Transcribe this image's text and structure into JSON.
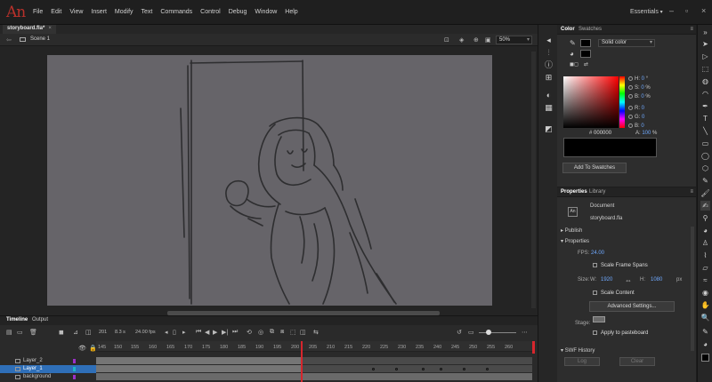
{
  "app": {
    "logo": "An"
  },
  "menu": [
    "File",
    "Edit",
    "View",
    "Insert",
    "Modify",
    "Text",
    "Commands",
    "Control",
    "Debug",
    "Window",
    "Help"
  ],
  "workspace": "Essentials",
  "document": {
    "tab": "storyboard.fla*",
    "close": "×"
  },
  "editbar": {
    "back": "⇦",
    "scene": "Scene 1",
    "zoom": "50%"
  },
  "timeline": {
    "tabs": [
      "Timeline",
      "Output"
    ],
    "frame": "201",
    "time": "8.3 s",
    "fps": "24.00 fps",
    "ruler": [
      "145",
      "150",
      "155",
      "160",
      "165",
      "170",
      "175",
      "180",
      "185",
      "190",
      "195",
      "200",
      "205",
      "210",
      "215",
      "220",
      "225",
      "230",
      "235",
      "240",
      "245",
      "250",
      "255",
      "260"
    ],
    "layers": [
      {
        "name": "Layer_2",
        "color": "#9b30c8",
        "selected": false
      },
      {
        "name": "Layer_1",
        "color": "#1fb5c8",
        "selected": true
      },
      {
        "name": "background",
        "color": "#9b30c8",
        "selected": false
      }
    ],
    "playhead_color": "#d6262d"
  },
  "color_panel": {
    "tabs": [
      "Color",
      "Swatches"
    ],
    "fill_type": "Solid color",
    "fields": [
      {
        "label": "H:",
        "value": "0",
        "unit": "°"
      },
      {
        "label": "S:",
        "value": "0",
        "unit": "%"
      },
      {
        "label": "B:",
        "value": "0",
        "unit": "%"
      },
      {
        "label": "R:",
        "value": "0",
        "unit": ""
      },
      {
        "label": "G:",
        "value": "0",
        "unit": ""
      },
      {
        "label": "B:",
        "value": "0",
        "unit": ""
      }
    ],
    "hex_label": "#",
    "hex": "000000",
    "alpha_label": "A:",
    "alpha": "100",
    "alpha_unit": "%",
    "add_button": "Add To Swatches"
  },
  "properties_panel": {
    "tabs": [
      "Properties",
      "Library"
    ],
    "doc_label": "Document",
    "file": "storyboard.fla",
    "publish": "Publish",
    "properties": "Properties",
    "fps_label": "FPS:",
    "fps": "24.00",
    "scale_frame_spans": "Scale Frame Spans",
    "size_label": "Size:",
    "w_label": "W:",
    "w": "1920",
    "h_label": "H:",
    "h": "1080",
    "unit": "px",
    "scale_content": "Scale Content",
    "advanced": "Advanced Settings...",
    "stage_label": "Stage:",
    "apply_pasteboard": "Apply to pasteboard",
    "swf_history": "SWF History",
    "log": "Log",
    "clear": "Clear"
  },
  "icons": {
    "chevron": "▾",
    "collapse": "◂"
  }
}
